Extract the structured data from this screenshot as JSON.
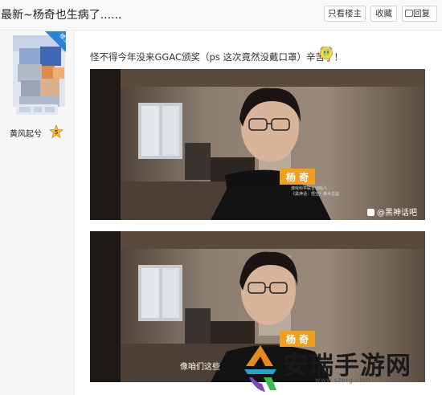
{
  "header": {
    "title": "最新~杨奇也生病了......",
    "btn_only_op": "只看楼主",
    "btn_collect": "收藏",
    "btn_reply": "回复"
  },
  "user": {
    "badge": "楼主",
    "level_title": "黄风起兮",
    "level_number": "5"
  },
  "post": {
    "text": "怪不得今年没来GGAC颁奖（ps 这次竟然没戴口罩）辛苦了！"
  },
  "frames": [
    {
      "name_tag": "杨 奇",
      "name_sub_1": "游戏科学联合创始人",
      "name_sub_2": "《黑神话：悟空》美术总监",
      "watermark": "@黑神话吧"
    },
    {
      "name_tag": "杨 奇",
      "subtitle": "像咱们这些"
    }
  ],
  "footer": {
    "name": "安瑞手游网",
    "url": "www.szerg.com"
  },
  "colors": {
    "accent_blue": "#2b83d6",
    "name_tag_orange": "#f0a020",
    "footer_text": "#1a1a1a"
  }
}
